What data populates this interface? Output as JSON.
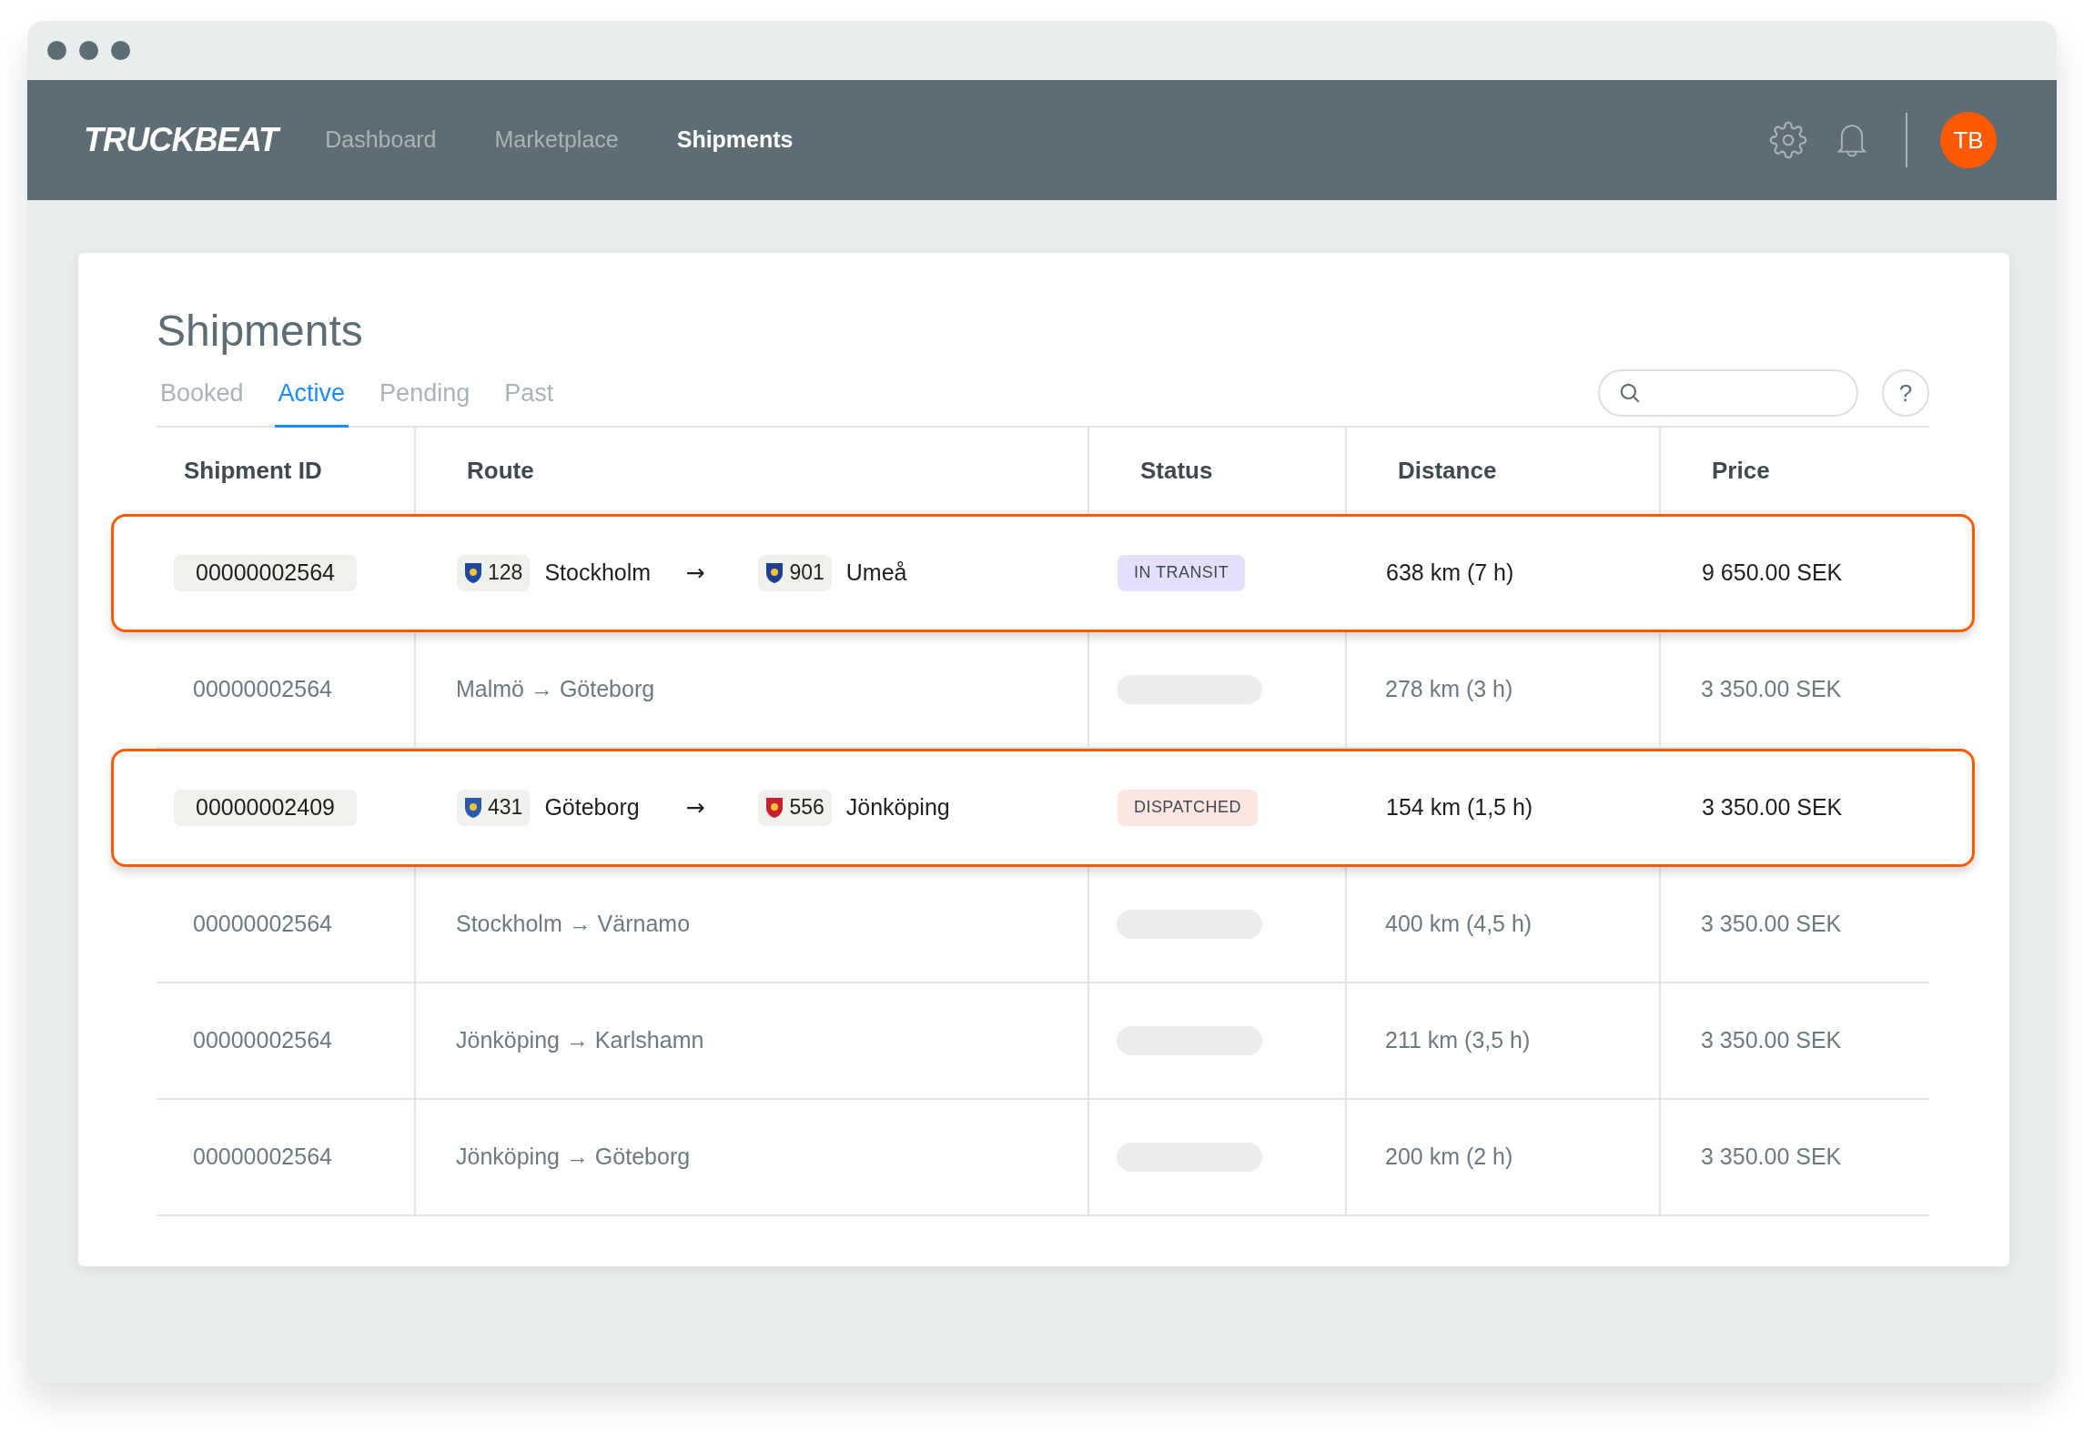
{
  "nav": {
    "logo": "TRUCKBEAT",
    "links": [
      {
        "label": "Dashboard",
        "selected": false
      },
      {
        "label": "Marketplace",
        "selected": false
      },
      {
        "label": "Shipments",
        "selected": true
      }
    ],
    "avatar": "TB"
  },
  "page": {
    "title": "Shipments",
    "tabs": [
      {
        "label": "Booked",
        "selected": false
      },
      {
        "label": "Active",
        "selected": true
      },
      {
        "label": "Pending",
        "selected": false
      },
      {
        "label": "Past",
        "selected": false
      }
    ],
    "help": "?"
  },
  "table": {
    "columns": [
      "Shipment ID",
      "Route",
      "Status",
      "Distance",
      "Price"
    ],
    "rows": [
      {
        "kind": "detailed",
        "highlighted": true,
        "id": "00000002564",
        "from": {
          "code": "128",
          "city": "Stockholm",
          "color": "#1b4aa0"
        },
        "arrow": "→",
        "to": {
          "code": "901",
          "city": "Umeå",
          "color": "#1d3f94"
        },
        "status": {
          "label": "IN TRANSIT",
          "color": "#e4e0fb"
        },
        "distance": "638 km (7 h)",
        "price": "9 650.00 SEK"
      },
      {
        "kind": "plain",
        "highlighted": false,
        "id": "00000002564",
        "route": "Malmö → Göteborg",
        "distance": "278 km (3 h)",
        "price": "3 350.00 SEK"
      },
      {
        "kind": "detailed",
        "highlighted": true,
        "id": "00000002409",
        "from": {
          "code": "431",
          "city": "Göteborg",
          "color": "#2b5bb0"
        },
        "arrow": "→",
        "to": {
          "code": "556",
          "city": "Jönköping",
          "color": "#c8202f"
        },
        "status": {
          "label": "DISPATCHED",
          "color": "#fde6e1"
        },
        "distance": "154 km (1,5 h)",
        "price": "3 350.00 SEK"
      },
      {
        "kind": "plain",
        "highlighted": false,
        "id": "00000002564",
        "route": "Stockholm → Värnamo",
        "distance": "400 km (4,5 h)",
        "price": "3 350.00 SEK"
      },
      {
        "kind": "plain",
        "highlighted": false,
        "id": "00000002564",
        "route": "Jönköping → Karlshamn",
        "distance": "211 km (3,5 h)",
        "price": "3 350.00 SEK"
      },
      {
        "kind": "plain",
        "highlighted": false,
        "id": "00000002564",
        "route": "Jönköping → Göteborg",
        "distance": "200 km (2 h)",
        "price": "3 350.00 SEK"
      }
    ]
  }
}
